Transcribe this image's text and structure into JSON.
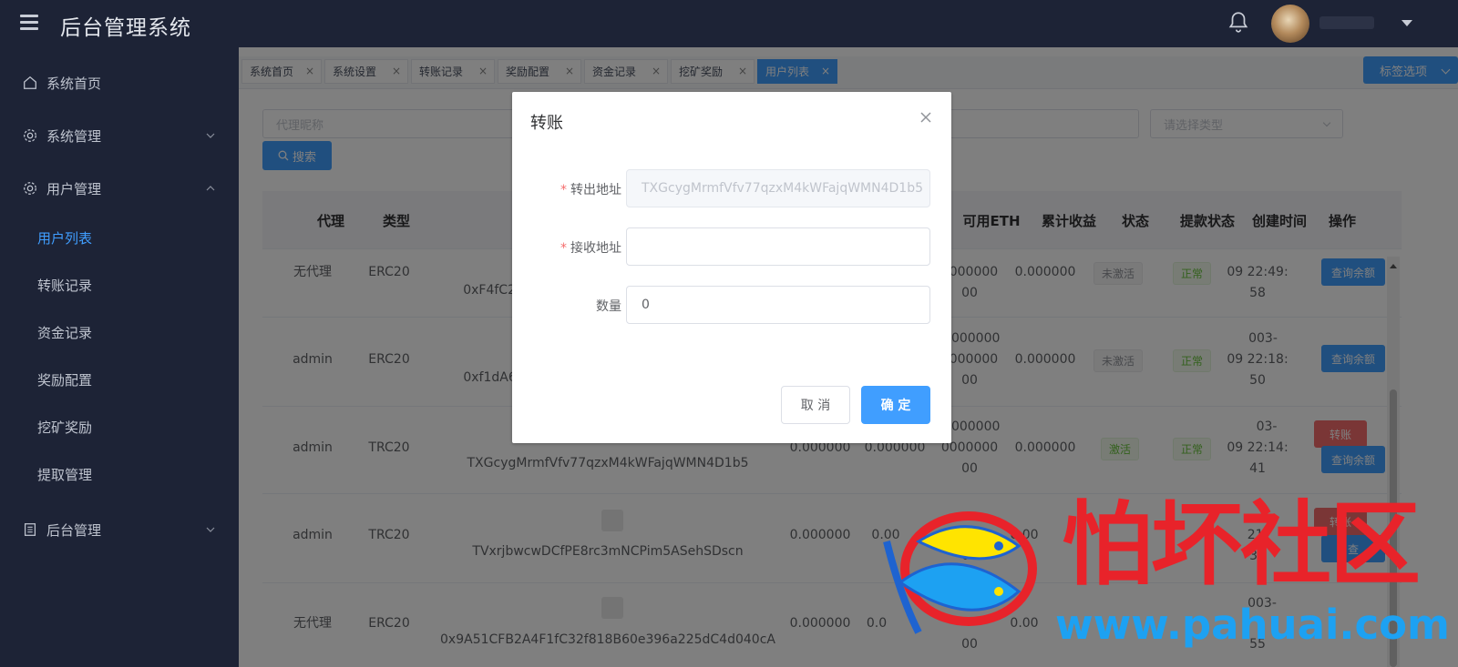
{
  "header": {
    "title": "后台管理系统"
  },
  "sidebar": {
    "items": [
      {
        "label": "系统首页"
      },
      {
        "label": "系统管理"
      },
      {
        "label": "用户管理"
      },
      {
        "label": "后台管理"
      }
    ],
    "sub_items": [
      {
        "label": "用户列表"
      },
      {
        "label": "转账记录"
      },
      {
        "label": "资金记录"
      },
      {
        "label": "奖励配置"
      },
      {
        "label": "挖矿奖励"
      },
      {
        "label": "提取管理"
      }
    ]
  },
  "tabs": [
    {
      "label": "系统首页"
    },
    {
      "label": "系统设置"
    },
    {
      "label": "转账记录"
    },
    {
      "label": "奖励配置"
    },
    {
      "label": "资金记录"
    },
    {
      "label": "挖矿奖励"
    },
    {
      "label": "用户列表"
    }
  ],
  "tab_close": "×",
  "tag_options_label": "标签选项",
  "filters": {
    "agent_placeholder": "代理昵称",
    "type_placeholder": "请选择类型",
    "search_label": "搜索"
  },
  "table": {
    "headers": [
      "代理",
      "类型",
      "可用ETH",
      "累计收益",
      "状态",
      "提款状态",
      "创建时间",
      "操作"
    ],
    "rows": [
      {
        "agent": "无代理",
        "type": "ERC20",
        "address": "0xF4fC2C",
        "eth_a": "",
        "eth_b": "",
        "eth": [
          "0000000",
          "00"
        ],
        "income": "0.000000",
        "status": "未激活",
        "withdraw": "正常",
        "time": [
          "09 22:49:",
          "58"
        ],
        "ops": [
          "查询余额"
        ]
      },
      {
        "agent": "admin",
        "type": "ERC20",
        "address": "0xf1dA64",
        "eth_a": "",
        "eth_b": "",
        "eth": [
          "0.000000",
          "0000000",
          "00"
        ],
        "income": "0.000000",
        "status": "未激活",
        "withdraw": "正常",
        "time": [
          "003-",
          "09 22:18:",
          "50"
        ],
        "ops": [
          "查询余额"
        ]
      },
      {
        "agent": "admin",
        "type": "TRC20",
        "address": "TXGcygMrmfVfv77qzxM4kWFajqWMN4D1b5",
        "eth_a": "0.000000",
        "eth_b": "0.000000",
        "eth": [
          "0.000000",
          "0000000",
          "00"
        ],
        "income": "0.000000",
        "status": "激活",
        "withdraw": "正常",
        "time": [
          "03-",
          "09 22:14:",
          "41"
        ],
        "ops": [
          "转账",
          "查询余额"
        ]
      },
      {
        "agent": "admin",
        "type": "TRC20",
        "address": "TVxrjbwcwDCfPE8rc3mNCPim5ASehSDscn",
        "eth_a": "0.000000",
        "eth_b": "0.00",
        "eth": [
          "",
          "00"
        ],
        "income": "0.00",
        "status": "",
        "withdraw": "",
        "time": [
          "21:",
          "36"
        ],
        "ops": [
          "转账",
          "查"
        ]
      },
      {
        "agent": "无代理",
        "type": "ERC20",
        "address": "0x9A51CFB2A4F1fC32f818B60e396a225dC4d040cA",
        "eth_a": "0.000000",
        "eth_b": "0.0",
        "eth": [
          "",
          "00"
        ],
        "income": "0.00",
        "status": "",
        "withdraw": "",
        "time": [
          "003-",
          "55"
        ],
        "ops": []
      }
    ]
  },
  "dialog": {
    "title": "转账",
    "from_label": "转出地址",
    "from_value": "TXGcygMrmfVfv77qzxM4kWFajqWMN4D1b5",
    "to_label": "接收地址",
    "to_value": "",
    "amount_label": "数量",
    "amount_value": "0",
    "required_mark": "*",
    "cancel_label": "取 消",
    "confirm_label": "确 定"
  },
  "watermark": {
    "text": "怕坏社区",
    "url": "www.pahuai.com"
  },
  "colors": {
    "primary": "#409eff",
    "sidebar": "#1d2336",
    "danger": "#f56c6c",
    "success": "#67c23a"
  }
}
